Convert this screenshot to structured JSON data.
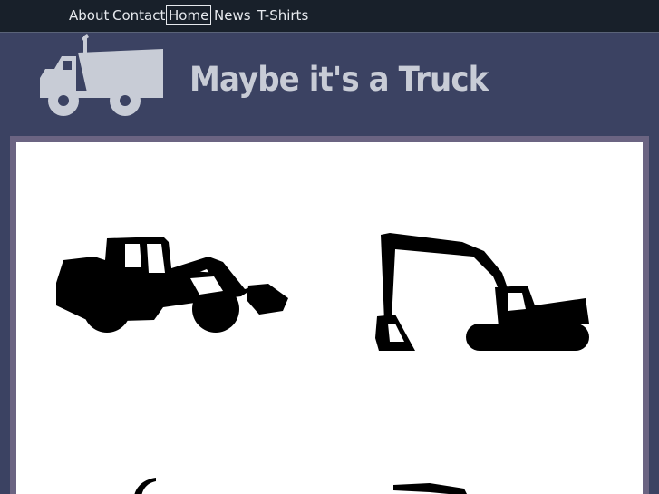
{
  "nav": {
    "items": [
      {
        "label": "About"
      },
      {
        "label": "Contact"
      },
      {
        "label": "Home",
        "active": true
      },
      {
        "label": "News"
      },
      {
        "label": "T-Shirts"
      }
    ]
  },
  "header": {
    "logo_icon": "dump-truck-icon",
    "title": "Maybe it's a Truck"
  },
  "gallery": {
    "items": [
      {
        "icon": "wheel-loader-icon"
      },
      {
        "icon": "excavator-icon"
      },
      {
        "icon": "crane-icon"
      },
      {
        "icon": "bulldozer-icon"
      }
    ]
  },
  "colors": {
    "nav_background": "#18202a",
    "page_background": "#3b4262",
    "frame": "#6b6482",
    "panel": "#ffffff",
    "title_text": "#c8ccd6",
    "nav_text": "#e6e9ee"
  }
}
